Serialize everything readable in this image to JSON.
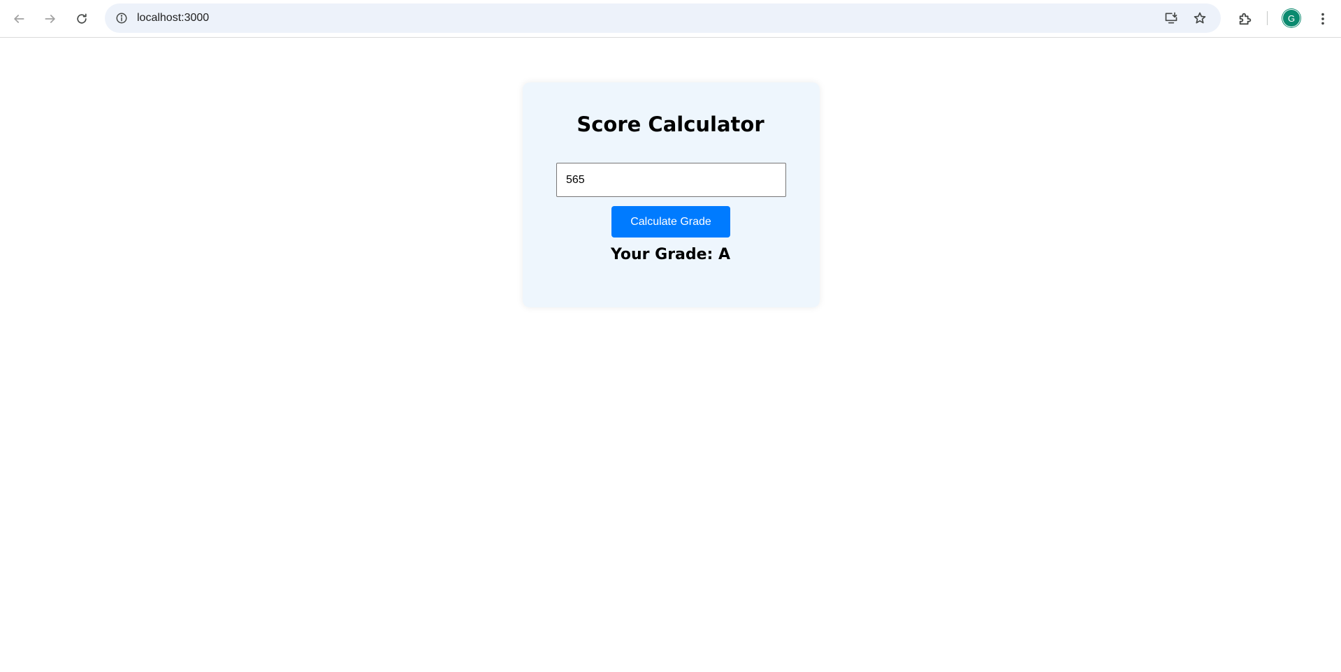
{
  "browser": {
    "url": "localhost:3000",
    "profile_initial": "G",
    "icons": {
      "back": "back-arrow-icon",
      "forward": "forward-arrow-icon",
      "reload": "reload-icon",
      "site_info": "info-icon",
      "install": "install-app-icon",
      "bookmark": "star-icon",
      "extensions": "puzzle-icon",
      "menu": "kebab-menu-icon"
    },
    "colors": {
      "omnibox_bg": "#edf2fa",
      "avatar_bg": "#0b8a6f"
    }
  },
  "app": {
    "title": "Score Calculator",
    "score_input": {
      "value": "565",
      "placeholder": ""
    },
    "calculate_button_label": "Calculate Grade",
    "result_text": "Your Grade: A",
    "colors": {
      "card_bg": "#eef6fd",
      "button_bg": "#007bff",
      "button_text": "#ffffff"
    }
  }
}
